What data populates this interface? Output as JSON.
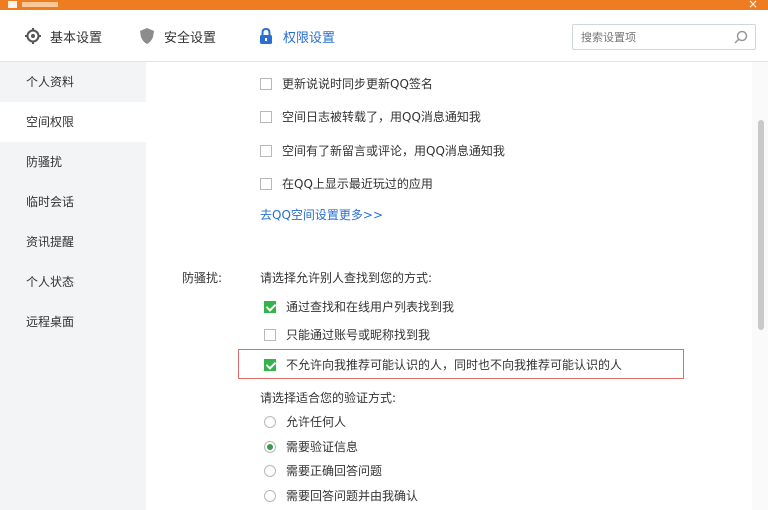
{
  "window": {
    "close_glyph": "×",
    "accent": "#f07c21"
  },
  "toolbar": {
    "tabs": [
      {
        "label": "基本设置",
        "icon": "gear-icon"
      },
      {
        "label": "安全设置",
        "icon": "shield-icon"
      },
      {
        "label": "权限设置",
        "icon": "lock-icon",
        "active": true
      }
    ],
    "search_placeholder": "搜索设置项"
  },
  "sidebar": {
    "items": [
      {
        "label": "个人资料"
      },
      {
        "label": "空间权限",
        "active": true
      },
      {
        "label": "防骚扰"
      },
      {
        "label": "临时会话"
      },
      {
        "label": "资讯提醒"
      },
      {
        "label": "个人状态"
      },
      {
        "label": "远程桌面"
      }
    ]
  },
  "content": {
    "space_options": [
      {
        "label": "更新说说时同步更新QQ签名",
        "checked": false
      },
      {
        "label": "空间日志被转载了，用QQ消息通知我",
        "checked": false
      },
      {
        "label": "空间有了新留言或评论，用QQ消息通知我",
        "checked": false
      },
      {
        "label": "在QQ上显示最近玩过的应用",
        "checked": false
      }
    ],
    "more_link": "去QQ空间设置更多>>",
    "anti_harass": {
      "label": "防骚扰:",
      "find_title": "请选择允许别人查找到您的方式:",
      "find_options": [
        {
          "label": "通过查找和在线用户列表找到我",
          "checked": true
        },
        {
          "label": "只能通过账号或昵称找到我",
          "checked": false
        },
        {
          "label": "不允许向我推荐可能认识的人，同时也不向我推荐可能认识的人",
          "checked": true,
          "highlighted": true
        }
      ],
      "verify_title": "请选择适合您的验证方式:",
      "verify_options": [
        {
          "label": "允许任何人",
          "selected": false
        },
        {
          "label": "需要验证信息",
          "selected": true
        },
        {
          "label": "需要正确回答问题",
          "selected": false
        },
        {
          "label": "需要回答问题并由我确认",
          "selected": false
        }
      ]
    }
  },
  "colors": {
    "link": "#2a6fd1",
    "check": "#34b34a",
    "highlight_border": "#e06b6b",
    "sidebar_bg": "#f3f4f6"
  }
}
